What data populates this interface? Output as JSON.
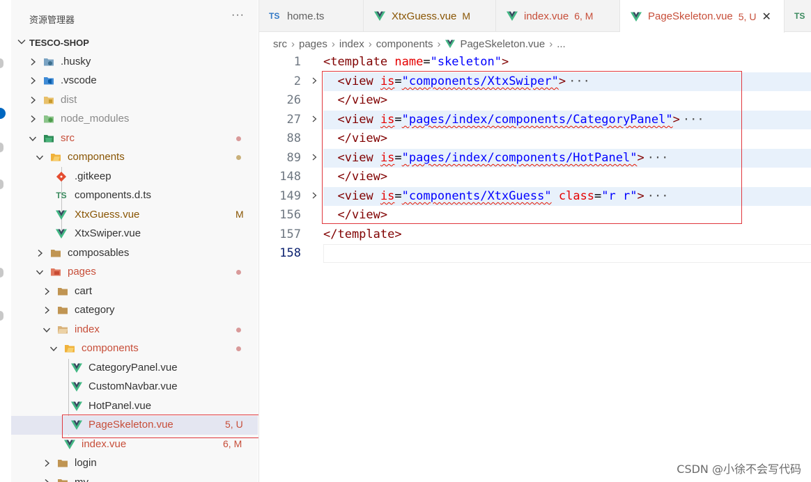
{
  "explorer": {
    "title": "资源管理器",
    "more_label": "···",
    "root_label": "TESCO-SHOP",
    "items": [
      {
        "label": ".husky",
        "icon": "husky-folder-icon"
      },
      {
        "label": ".vscode",
        "icon": "vscode-folder-icon"
      },
      {
        "label": "dist",
        "icon": "dist-folder-icon"
      },
      {
        "label": "node_modules",
        "icon": "node-folder-icon"
      },
      {
        "label": "src",
        "icon": "src-folder-icon"
      },
      {
        "label": "components",
        "icon": "components-folder-icon"
      },
      {
        "label": ".gitkeep",
        "icon": "git-icon"
      },
      {
        "label": "components.d.ts",
        "icon": "ts-icon",
        "icon_text": "TS"
      },
      {
        "label": "XtxGuess.vue",
        "icon": "vue-icon",
        "status": "M"
      },
      {
        "label": "XtxSwiper.vue",
        "icon": "vue-icon"
      },
      {
        "label": "composables",
        "icon": "folder-icon"
      },
      {
        "label": "pages",
        "icon": "pages-folder-icon"
      },
      {
        "label": "cart",
        "icon": "folder-icon"
      },
      {
        "label": "category",
        "icon": "folder-icon"
      },
      {
        "label": "index",
        "icon": "folder-open-icon"
      },
      {
        "label": "components",
        "icon": "components-folder-icon"
      },
      {
        "label": "CategoryPanel.vue",
        "icon": "vue-icon"
      },
      {
        "label": "CustomNavbar.vue",
        "icon": "vue-icon"
      },
      {
        "label": "HotPanel.vue",
        "icon": "vue-icon"
      },
      {
        "label": "PageSkeleton.vue",
        "icon": "vue-icon",
        "status": "5, U"
      },
      {
        "label": "index.vue",
        "icon": "vue-icon",
        "status": "6, M"
      },
      {
        "label": "login",
        "icon": "folder-icon"
      },
      {
        "label": "my",
        "icon": "folder-icon"
      }
    ]
  },
  "tabs": [
    {
      "label": "home.ts",
      "icon": "ts-icon",
      "icon_text": "TS",
      "status": ""
    },
    {
      "label": "XtxGuess.vue",
      "icon": "vue-icon",
      "status": "M"
    },
    {
      "label": "index.vue",
      "icon": "vue-icon",
      "status": "6, M"
    },
    {
      "label": "PageSkeleton.vue",
      "icon": "vue-icon",
      "status": "5, U",
      "close": "✕"
    },
    {
      "label": "",
      "icon": "ts-icon",
      "icon_text": "TS"
    }
  ],
  "breadcrumb": [
    "src",
    "pages",
    "index",
    "components",
    "PageSkeleton.vue",
    "..."
  ],
  "code": {
    "lines": [
      {
        "num": "1",
        "tag": "template",
        "attr": "name",
        "value": "\"skeleton\""
      },
      {
        "num": "2",
        "tag": "view",
        "attr": "is",
        "value": "\"components/XtxSwiper\""
      },
      {
        "num": "26",
        "close": "</view>"
      },
      {
        "num": "27",
        "tag": "view",
        "attr": "is",
        "value": "\"pages/index/components/CategoryPanel\""
      },
      {
        "num": "88",
        "close": "</view>"
      },
      {
        "num": "89",
        "tag": "view",
        "attr": "is",
        "value": "\"pages/index/components/HotPanel\""
      },
      {
        "num": "148",
        "close": "</view>"
      },
      {
        "num": "149",
        "tag": "view",
        "attr": "is",
        "value": "\"components/XtxGuess\"",
        "attr2": "class",
        "value2": "\"r r\""
      },
      {
        "num": "156",
        "close": "</view>"
      },
      {
        "num": "157",
        "close": "</template>"
      },
      {
        "num": "158"
      }
    ],
    "fold_ellipsis": "···"
  },
  "watermark": "CSDN @小徐不会写代码",
  "colors": {
    "vue_green": "#41b883",
    "vue_dark": "#34495e",
    "highlight_red": "#e0373d",
    "status_modified": "#895503",
    "status_error": "#c74e39"
  }
}
